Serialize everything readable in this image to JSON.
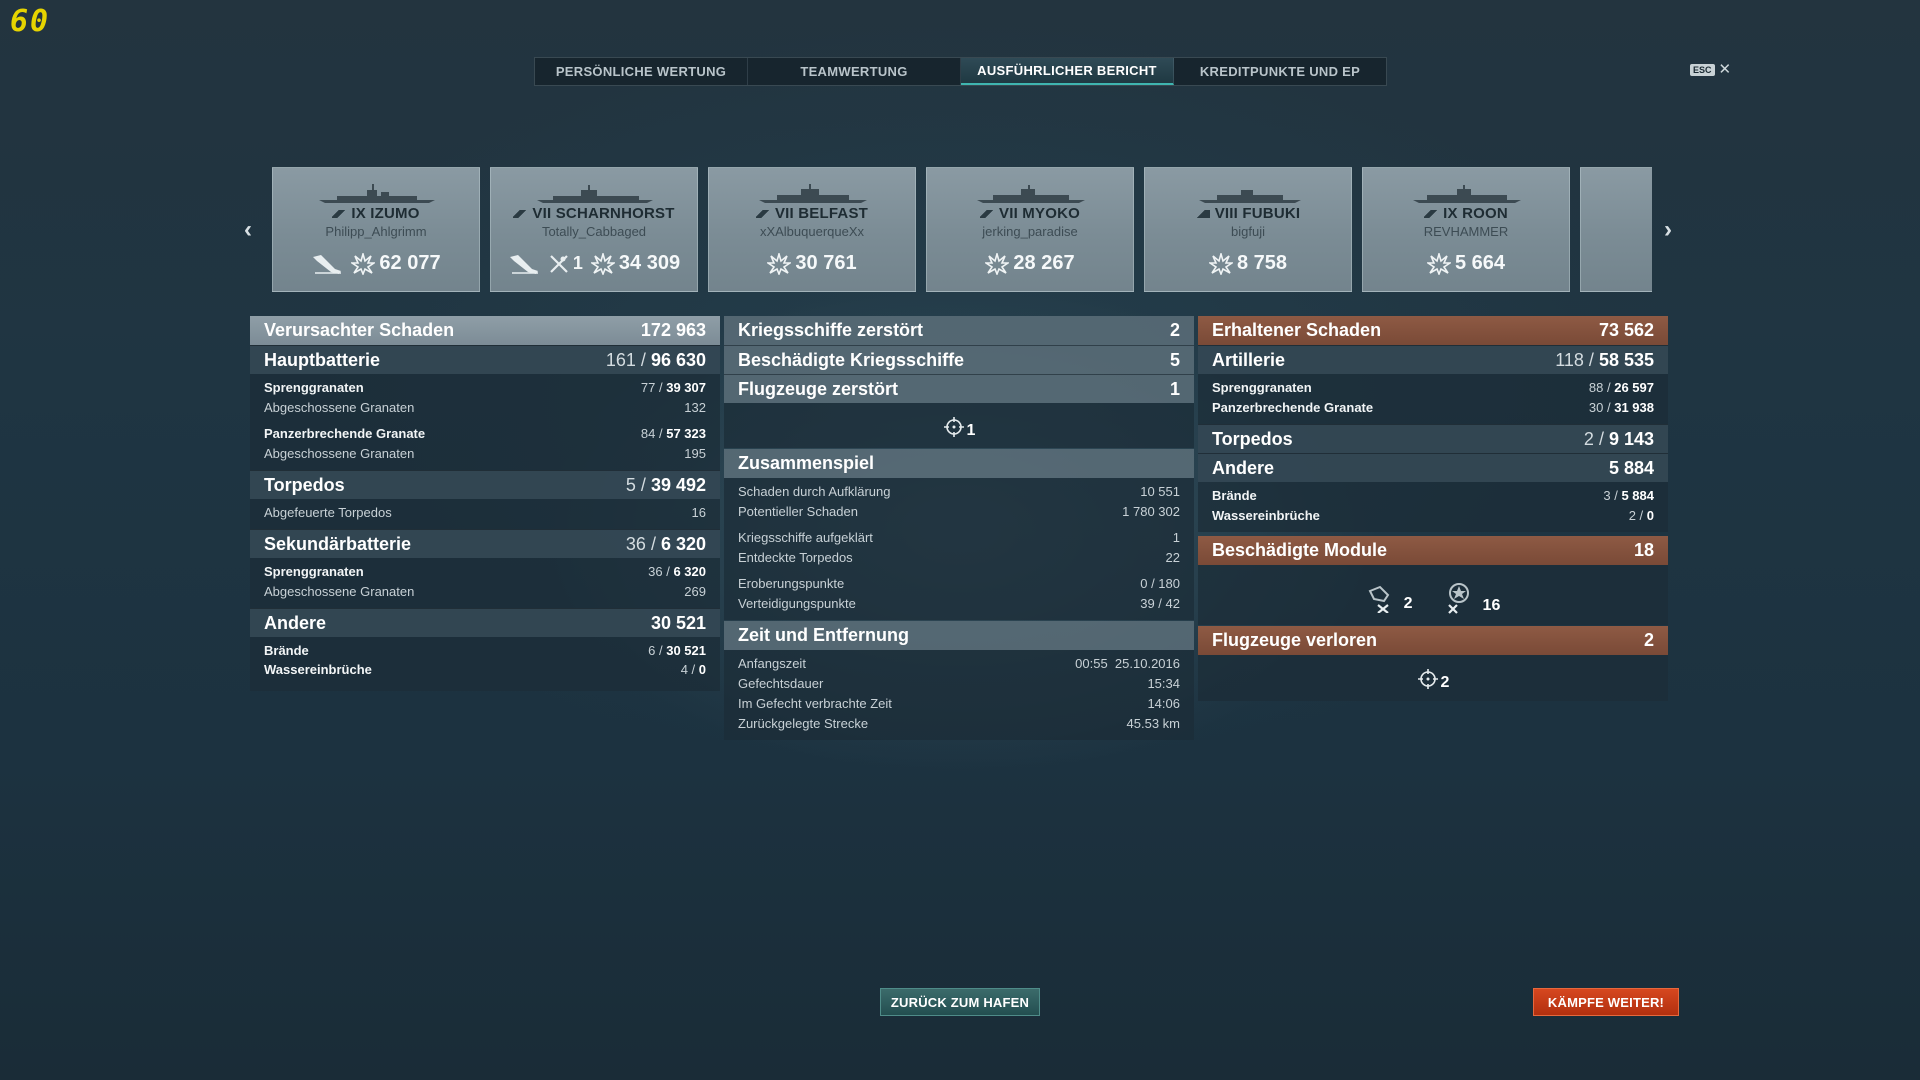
{
  "fps": "60",
  "tabs": [
    {
      "label": "PERSÖNLICHE WERTUNG"
    },
    {
      "label": "TEAMWERTUNG"
    },
    {
      "label": "AUSFÜHRLICHER BERICHT"
    },
    {
      "label": "KREDITPUNKTE UND EP"
    }
  ],
  "esc": {
    "key": "ESC",
    "close": "✕"
  },
  "ships": [
    {
      "tier_name": "IX IZUMO",
      "player": "Philipp_Ahlgrimm",
      "damage": "62 077",
      "plane_kills": "",
      "ship_class": "battleship"
    },
    {
      "tier_name": "VII SCHARNHORST",
      "player": "Totally_Cabbaged",
      "damage": "34 309",
      "plane_kills": "1",
      "ship_class": "battleship"
    },
    {
      "tier_name": "VII BELFAST",
      "player": "xXAlbuquerqueXx",
      "damage": "30 761",
      "plane_kills": "",
      "ship_class": "cruiser"
    },
    {
      "tier_name": "VII MYOKO",
      "player": "jerking_paradise",
      "damage": "28 267",
      "plane_kills": "",
      "ship_class": "cruiser"
    },
    {
      "tier_name": "VIII FUBUKI",
      "player": "bigfuji",
      "damage": "8 758",
      "plane_kills": "",
      "ship_class": "destroyer"
    },
    {
      "tier_name": "IX ROON",
      "player": "REVHAMMER",
      "damage": "5 664",
      "plane_kills": "",
      "ship_class": "cruiser"
    }
  ],
  "dealt": {
    "title": "Verursachter Schaden",
    "total": "172 963",
    "main": {
      "label": "Hauptbatterie",
      "hits": "161",
      "damage": "96 630"
    },
    "he": {
      "label": "Sprenggranaten",
      "hits": "77",
      "damage": "39 307"
    },
    "he_fired": {
      "label": "Abgeschossene Granaten",
      "value": "132"
    },
    "ap": {
      "label": "Panzerbrechende Granate",
      "hits": "84",
      "damage": "57 323"
    },
    "ap_fired": {
      "label": "Abgeschossene Granaten",
      "value": "195"
    },
    "torp": {
      "label": "Torpedos",
      "hits": "5",
      "damage": "39 492"
    },
    "torp_fired": {
      "label": "Abgefeuerte Torpedos",
      "value": "16"
    },
    "sec": {
      "label": "Sekundärbatterie",
      "hits": "36",
      "damage": "6 320"
    },
    "sec_he": {
      "label": "Sprenggranaten",
      "hits": "36",
      "damage": "6 320"
    },
    "sec_fired": {
      "label": "Abgeschossene Granaten",
      "value": "269"
    },
    "other": {
      "label": "Andere",
      "damage": "30 521"
    },
    "fires": {
      "label": "Brände",
      "count": "6",
      "damage": "30 521"
    },
    "flood": {
      "label": "Wassereinbrüche",
      "count": "4",
      "damage": "0"
    }
  },
  "kills": {
    "ships_destroyed": {
      "label": "Kriegsschiffe zerstört",
      "value": "2"
    },
    "ships_damaged": {
      "label": "Beschädigte Kriegsschiffe",
      "value": "5"
    },
    "planes_destroyed": {
      "label": "Flugzeuge zerstört",
      "value": "1"
    },
    "planes_icon_count": "1"
  },
  "team": {
    "title": "Zusammenspiel",
    "rows": [
      {
        "label": "Schaden durch Aufklärung",
        "value": "10 551"
      },
      {
        "label": "Potentieller Schaden",
        "value": "1 780 302"
      },
      {
        "label": "Kriegsschiffe aufgeklärt",
        "value": "1"
      },
      {
        "label": "Entdeckte Torpedos",
        "value": "22"
      },
      {
        "label": "Eroberungspunkte",
        "value": "0 / 180"
      },
      {
        "label": "Verteidigungspunkte",
        "value": "39 / 42"
      }
    ]
  },
  "time": {
    "title": "Zeit und Entfernung",
    "rows": [
      {
        "label": "Anfangszeit",
        "value": "00:55  25.10.2016"
      },
      {
        "label": "Gefechtsdauer",
        "value": "15:34"
      },
      {
        "label": "Im Gefecht verbrachte Zeit",
        "value": "14:06"
      },
      {
        "label": "Zurückgelegte Strecke",
        "value": "45.53 km"
      }
    ]
  },
  "received": {
    "title": "Erhaltener Schaden",
    "total": "73 562",
    "art": {
      "label": "Artillerie",
      "hits": "118",
      "damage": "58 535"
    },
    "he": {
      "label": "Sprenggranaten",
      "hits": "88",
      "damage": "26 597"
    },
    "ap": {
      "label": "Panzerbrechende Granate",
      "hits": "30",
      "damage": "31 938"
    },
    "torp": {
      "label": "Torpedos",
      "hits": "2",
      "damage": "9 143"
    },
    "other": {
      "label": "Andere",
      "damage": "5 884"
    },
    "fires": {
      "label": "Brände",
      "count": "3",
      "damage": "5 884"
    },
    "flood": {
      "label": "Wassereinbrüche",
      "count": "2",
      "damage": "0"
    },
    "modules": {
      "label": "Beschädigte Module",
      "value": "18",
      "guns": "2",
      "aa": "16"
    },
    "planes_lost": {
      "label": "Flugzeuge verloren",
      "value": "2",
      "icon_count": "2"
    }
  },
  "buttons": {
    "harbor": "ZURÜCK ZUM HAFEN",
    "battle": "KÄMPFE WEITER!"
  },
  "colors": {
    "accent": "#3fb5b0",
    "received": "#8e5a44",
    "battle_button": "#c63a17"
  }
}
